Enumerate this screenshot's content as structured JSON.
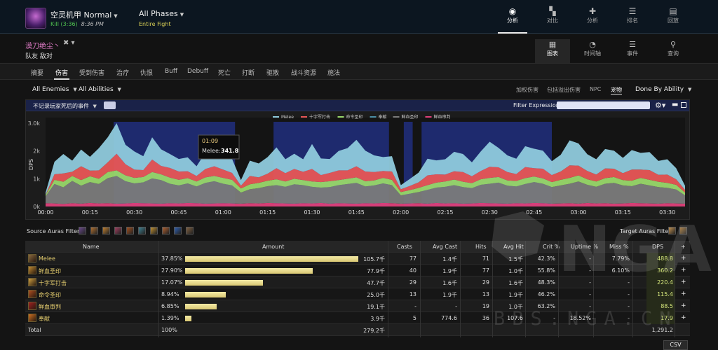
{
  "header": {
    "character_name": "空灵机甲 Normal",
    "kill": "Kill (3:36)",
    "kill_time": "8:36 PM",
    "phase": "All Phases",
    "phase_sub": "Entire Fight",
    "nav": [
      "分析",
      "对比",
      "分析",
      "排名",
      "回放"
    ]
  },
  "subheader": {
    "friendly": "漠刀绝尘丶",
    "friendly_sub": "队友 敌对",
    "views": [
      "图表",
      "时间轴",
      "事件",
      "查询"
    ]
  },
  "tabs": [
    "摘要",
    "伤害",
    "受到伤害",
    "治疗",
    "仇恨",
    "Buff",
    "Debuff",
    "死亡",
    "打断",
    "驱散",
    "战斗资源",
    "施法"
  ],
  "filters": {
    "enemies": "All Enemies",
    "abilities": "All Abilities",
    "options": [
      "加权伤害",
      "包括溢出伤害",
      "NPC",
      "宠物"
    ],
    "done_by": "Done By Ability"
  },
  "panel": {
    "death_filter": "不记录玩家死后的事件",
    "expr_label": "Filter Expression:"
  },
  "chart_data": {
    "type": "area",
    "ylabel": "DPS",
    "y_ticks": [
      "3.0k",
      "2k",
      "1k",
      "0k"
    ],
    "y_tick_values": [
      3000,
      2000,
      1000,
      0
    ],
    "ylim": [
      0,
      3200
    ],
    "x_ticks": [
      "00:00",
      "00:15",
      "00:30",
      "00:45",
      "01:00",
      "01:15",
      "01:30",
      "01:45",
      "02:00",
      "02:15",
      "02:30",
      "02:45",
      "03:00",
      "03:15",
      "03:30"
    ],
    "x_tick_seconds": [
      0,
      15,
      30,
      45,
      60,
      75,
      90,
      105,
      120,
      135,
      150,
      165,
      180,
      195,
      210
    ],
    "x_seconds": [
      0,
      3,
      6,
      9,
      12,
      15,
      18,
      21,
      24,
      27,
      30,
      33,
      36,
      39,
      42,
      45,
      48,
      51,
      54,
      57,
      60,
      63,
      66,
      69,
      72,
      75,
      78,
      81,
      84,
      87,
      90,
      93,
      96,
      99,
      102,
      105,
      108,
      111,
      114,
      117,
      120,
      123,
      126,
      129,
      132,
      135,
      138,
      141,
      144,
      147,
      150,
      153,
      156,
      159,
      162,
      165,
      168,
      171,
      174,
      177,
      180,
      183,
      186,
      189,
      192,
      195,
      198,
      201,
      204,
      207,
      210,
      213,
      216
    ],
    "highlight_ranges": [
      [
        23,
        64
      ],
      [
        77,
        116
      ],
      [
        121,
        124
      ],
      [
        127,
        171
      ]
    ],
    "legend": [
      "Melee",
      "十字军打击",
      "命令圣印",
      "奉献",
      "鲜血圣印",
      "鲜血审判"
    ],
    "colors": [
      "#8fcadc",
      "#e85656",
      "#99d86a",
      "#4c8fa6",
      "#7b7b7b",
      "#e0407a"
    ],
    "series": [
      {
        "name": "鲜血审判",
        "values": [
          120,
          110,
          90,
          120,
          100,
          130,
          110,
          120,
          100,
          110,
          130,
          120,
          110,
          100,
          120,
          110,
          130,
          120,
          100,
          110,
          120,
          110,
          100,
          120,
          110,
          130,
          120,
          110,
          100,
          120,
          110,
          130,
          100,
          120,
          110,
          100,
          120,
          110,
          130,
          120,
          100,
          110,
          120,
          100,
          130,
          110,
          120,
          100,
          110,
          130,
          120,
          110,
          100,
          120,
          110,
          130,
          120,
          100,
          110,
          120,
          100,
          130,
          110,
          120,
          100,
          110,
          130,
          120,
          110,
          100,
          120,
          110,
          100
        ]
      },
      {
        "name": "鲜血圣印",
        "values": [
          250,
          700,
          600,
          800,
          650,
          750,
          700,
          900,
          1000,
          800,
          700,
          750,
          900,
          850,
          700,
          650,
          700,
          600,
          750,
          800,
          700,
          650,
          400,
          500,
          550,
          600,
          650,
          600,
          700,
          650,
          600,
          550,
          600,
          650,
          700,
          750,
          600,
          650,
          700,
          650,
          300,
          350,
          400,
          500,
          550,
          600,
          650,
          600,
          550,
          650,
          700,
          750,
          650,
          600,
          700,
          750,
          700,
          600,
          650,
          700,
          800,
          650,
          600,
          700,
          750,
          650,
          600,
          700,
          650,
          600,
          550,
          500,
          300
        ]
      },
      {
        "name": "命令圣印",
        "values": [
          50,
          150,
          200,
          180,
          200,
          210,
          190,
          220,
          200,
          210,
          200,
          190,
          230,
          210,
          220,
          200,
          190,
          180,
          200,
          190,
          210,
          200,
          150,
          180,
          190,
          200,
          210,
          190,
          200,
          180,
          190,
          200,
          210,
          180,
          190,
          200,
          190,
          180,
          200,
          190,
          120,
          130,
          150,
          170,
          180,
          190,
          200,
          190,
          180,
          200,
          210,
          200,
          190,
          200,
          210,
          200,
          190,
          180,
          200,
          210,
          220,
          200,
          190,
          200,
          210,
          190,
          200,
          210,
          200,
          190,
          180,
          170,
          100
        ]
      },
      {
        "name": "十字军打击",
        "values": [
          0,
          200,
          300,
          150,
          500,
          200,
          300,
          350,
          600,
          400,
          300,
          250,
          450,
          300,
          350,
          300,
          250,
          200,
          300,
          350,
          300,
          250,
          100,
          300,
          200,
          250,
          400,
          300,
          350,
          300,
          450,
          250,
          300,
          350,
          300,
          400,
          350,
          300,
          250,
          300,
          100,
          150,
          200,
          350,
          300,
          250,
          300,
          350,
          250,
          300,
          400,
          350,
          300,
          250,
          400,
          300,
          350,
          250,
          300,
          450,
          350,
          300,
          250,
          350,
          300,
          250,
          400,
          300,
          350,
          250,
          300,
          200,
          100
        ]
      },
      {
        "name": "Melee",
        "values": [
          80,
          450,
          700,
          400,
          600,
          500,
          800,
          900,
          1100,
          700,
          650,
          500,
          800,
          600,
          500,
          450,
          500,
          350,
          600,
          700,
          600,
          500,
          200,
          550,
          500,
          600,
          750,
          500,
          550,
          450,
          900,
          600,
          500,
          700,
          800,
          950,
          750,
          600,
          500,
          550,
          150,
          250,
          350,
          600,
          500,
          550,
          700,
          650,
          500,
          700,
          900,
          700,
          600,
          550,
          750,
          700,
          650,
          500,
          600,
          900,
          800,
          600,
          550,
          700,
          650,
          550,
          700,
          600,
          650,
          500,
          550,
          400,
          150
        ]
      }
    ],
    "tooltip": {
      "time": "01:09",
      "label": "Melee:",
      "value": "341.8"
    }
  },
  "auras": {
    "source_label": "Source Auras Filter:",
    "target_label": "Target Auras Filter:",
    "source_colors": [
      "#6a4a8a",
      "#b07030",
      "#c08030",
      "#a04060",
      "#a05020",
      "#408090",
      "#c09030",
      "#b06030",
      "#3060b0",
      "#806040"
    ],
    "target_colors": [
      "#c09050",
      "#a07030"
    ]
  },
  "table": {
    "headers": [
      "Name",
      "Amount",
      "Casts",
      "Avg Cast",
      "Hits",
      "Avg Hit",
      "Crit %",
      "Uptime %",
      "Miss %",
      "DPS",
      "+"
    ],
    "rows": [
      {
        "name": "Melee",
        "pct": "37.85%",
        "fraction": 1.0,
        "amount": "105.7千",
        "casts": "77",
        "avg_cast": "1.4千",
        "hits": "71",
        "avg_hit": "1.5千",
        "crit": "42.3%",
        "uptime": "-",
        "miss": "7.79%",
        "dps": "488.8",
        "icon_color": "#8a6a40"
      },
      {
        "name": "鲜血圣印",
        "pct": "27.90%",
        "fraction": 0.737,
        "amount": "77.9千",
        "casts": "40",
        "avg_cast": "1.9千",
        "hits": "77",
        "avg_hit": "1.0千",
        "crit": "55.8%",
        "uptime": "-",
        "miss": "6.10%",
        "dps": "360.2",
        "icon_color": "#c08a30"
      },
      {
        "name": "十字军打击",
        "pct": "17.07%",
        "fraction": 0.451,
        "amount": "47.7千",
        "casts": "29",
        "avg_cast": "1.6千",
        "hits": "29",
        "avg_hit": "1.6千",
        "crit": "48.3%",
        "uptime": "-",
        "miss": "-",
        "dps": "220.4",
        "icon_color": "#d0a040"
      },
      {
        "name": "命令圣印",
        "pct": "8.94%",
        "fraction": 0.236,
        "amount": "25.0千",
        "casts": "13",
        "avg_cast": "1.9千",
        "hits": "13",
        "avg_hit": "1.9千",
        "crit": "46.2%",
        "uptime": "-",
        "miss": "-",
        "dps": "115.4",
        "icon_color": "#b05020"
      },
      {
        "name": "鲜血审判",
        "pct": "6.85%",
        "fraction": 0.181,
        "amount": "19.1千",
        "casts": "-",
        "avg_cast": "-",
        "hits": "19",
        "avg_hit": "1.0千",
        "crit": "63.2%",
        "uptime": "-",
        "miss": "-",
        "dps": "88.5",
        "icon_color": "#a02020"
      },
      {
        "name": "奉献",
        "pct": "1.39%",
        "fraction": 0.037,
        "amount": "3.9千",
        "casts": "5",
        "avg_cast": "774.6",
        "hits": "36",
        "avg_hit": "107.6",
        "crit": "-",
        "uptime": "18.52%",
        "miss": "-",
        "dps": "17.9",
        "icon_color": "#d07020"
      }
    ],
    "total": {
      "label": "Total",
      "pct": "100%",
      "amount": "279.2千",
      "dps": "1,291.2"
    },
    "csv_label": "CSV"
  },
  "watermark": "BBS.NGA.CN"
}
